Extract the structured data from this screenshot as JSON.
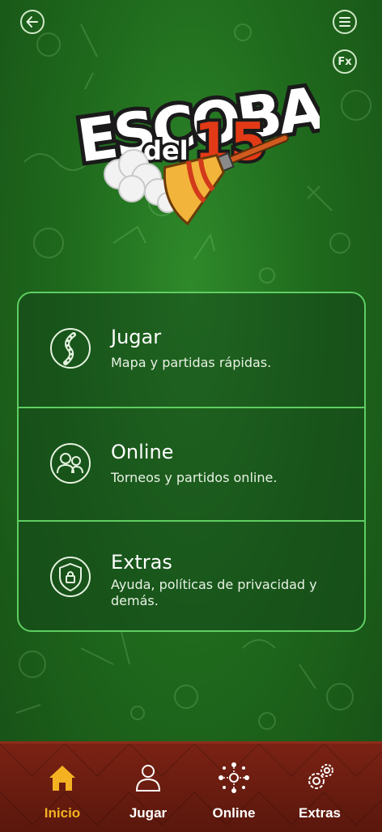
{
  "header": {
    "back_icon": "arrow-left-icon",
    "menu_icon": "hamburger-menu-icon",
    "fx_label": "Fx"
  },
  "logo": {
    "word1": "ESCOBA",
    "word2": "del",
    "number": "15"
  },
  "menu": {
    "items": [
      {
        "title": "Jugar",
        "subtitle": "Mapa y partidas rápidas.",
        "icon": "map-path-icon"
      },
      {
        "title": "Online",
        "subtitle": "Torneos y partidos online.",
        "icon": "users-icon"
      },
      {
        "title": "Extras",
        "subtitle": "Ayuda, políticas de privacidad y demás.",
        "icon": "shield-lock-icon"
      }
    ]
  },
  "tabbar": {
    "tabs": [
      {
        "label": "Inicio",
        "icon": "home-icon",
        "active": true
      },
      {
        "label": "Jugar",
        "icon": "user-icon",
        "active": false
      },
      {
        "label": "Online",
        "icon": "network-icon",
        "active": false
      },
      {
        "label": "Extras",
        "icon": "gears-icon",
        "active": false
      }
    ],
    "active_color": "#f4b223"
  },
  "colors": {
    "background": "#1f6a1d",
    "panel_border": "#5fce62",
    "tabbar": "#6a1c10"
  }
}
